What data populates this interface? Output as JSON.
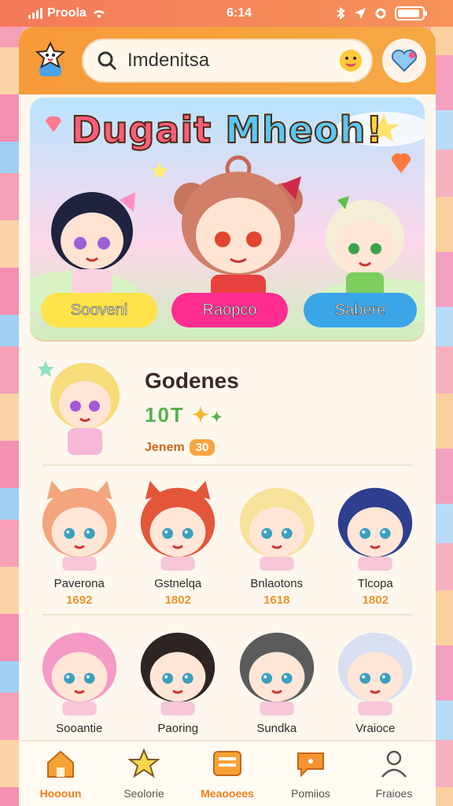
{
  "status_bar": {
    "carrier": "Proola",
    "time": "6:14",
    "battery_level": 0.9
  },
  "header": {
    "search_text": "Imdenitsa",
    "icons": [
      "mascot-icon",
      "search-icon",
      "emoji-icon",
      "heart-icon"
    ]
  },
  "banner": {
    "title_parts": [
      "Dugait ",
      "Mheoh",
      "!"
    ],
    "buttons": [
      {
        "label": "Soovenl",
        "color": "#ffe34a"
      },
      {
        "label": "Raopco",
        "color": "#ff2d91"
      },
      {
        "label": "Sabere",
        "color": "#3aa6e8"
      }
    ]
  },
  "featured": {
    "name": "Godenes",
    "score": "10T",
    "meta": "Jenem",
    "badge": "30"
  },
  "row1": [
    {
      "name": "Paverona",
      "score": "1692",
      "hair": "#f4a57e",
      "ears": true
    },
    {
      "name": "Gstnelqa",
      "score": "1802",
      "hair": "#e4563a",
      "ears": true
    },
    {
      "name": "Bnlaotons",
      "score": "1618",
      "hair": "#f6e29a",
      "ears": false
    },
    {
      "name": "Tlcopa",
      "score": "1802",
      "hair": "#2e3f8f",
      "ears": false
    }
  ],
  "row2": [
    {
      "name": "Sooantie",
      "hair": "#f59ac6"
    },
    {
      "name": "Paoring",
      "hair": "#2e2422"
    },
    {
      "name": "Sundka",
      "hair": "#5b5b5b"
    },
    {
      "name": "Vraioce",
      "hair": "#d8dff1"
    }
  ],
  "bottom_nav": [
    {
      "label": "Hoooun",
      "icon": "home-icon",
      "active": true
    },
    {
      "label": "Seolorie",
      "icon": "star-icon",
      "active": false
    },
    {
      "label": "Meaooees",
      "icon": "message-box-icon",
      "active": true
    },
    {
      "label": "Pomiios",
      "icon": "chat-bubble-icon",
      "active": false
    },
    {
      "label": "Fraioes",
      "icon": "profile-icon",
      "active": false
    }
  ]
}
